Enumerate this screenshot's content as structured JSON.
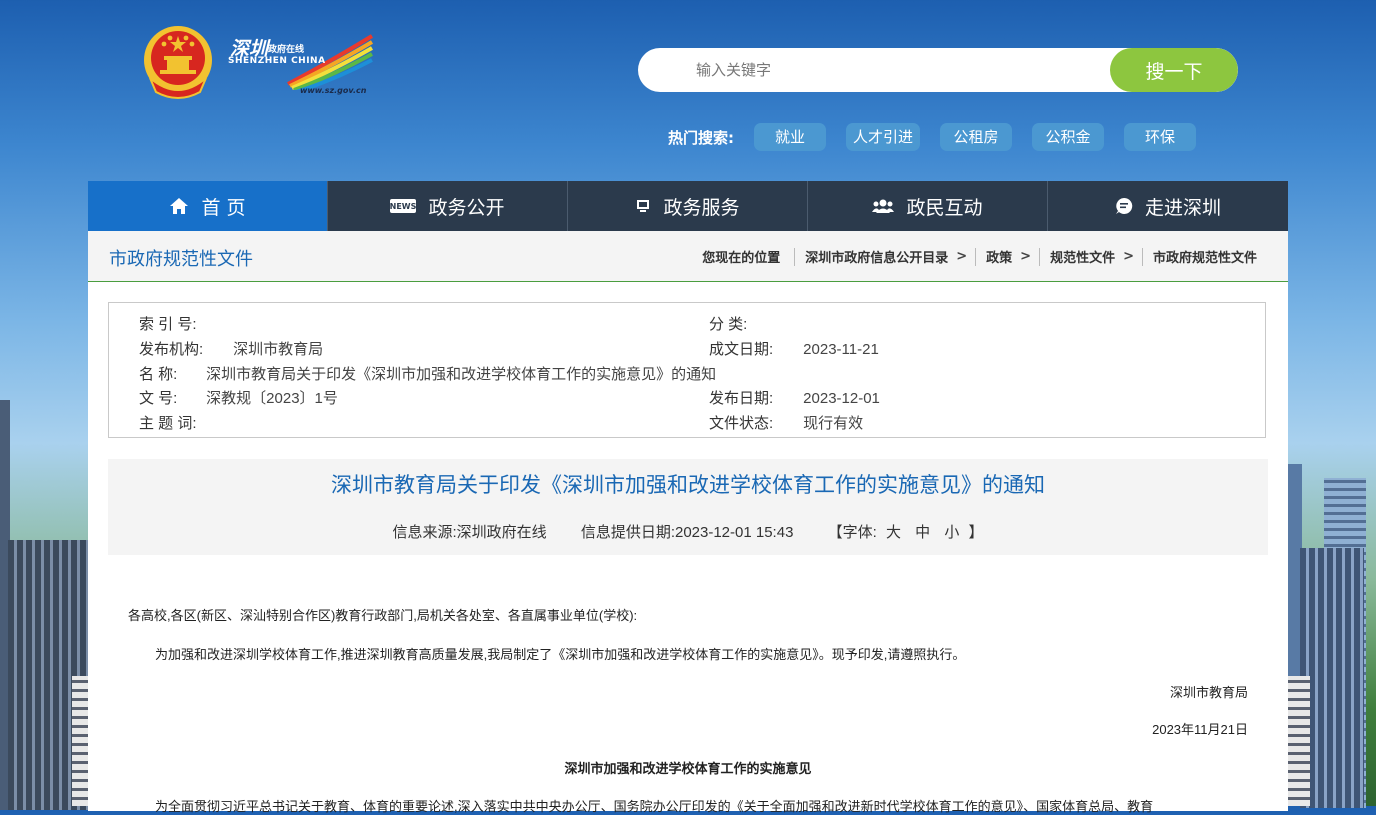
{
  "header": {
    "logo_cn": "深圳",
    "logo_cn2": "政府在线",
    "logo_en": "SHENZHEN CHINA",
    "logo_url": "www.sz.gov.cn",
    "search_placeholder": "输入关键字",
    "search_button": "搜一下",
    "hot_label": "热门搜索:",
    "hot_tags": [
      "就业",
      "人才引进",
      "公租房",
      "公积金",
      "环保"
    ]
  },
  "nav": {
    "items": [
      {
        "label": "首 页",
        "icon": "home-icon"
      },
      {
        "label": "政务公开",
        "icon": "news-icon"
      },
      {
        "label": "政务服务",
        "icon": "monitor-icon"
      },
      {
        "label": "政民互动",
        "icon": "users-icon"
      },
      {
        "label": "走进深圳",
        "icon": "chat-icon"
      }
    ]
  },
  "crumbbar": {
    "section_title": "市政府规范性文件",
    "location_label": "您现在的位置",
    "crumbs": [
      "深圳市政府信息公开目录",
      "政策",
      "规范性文件",
      "市政府规范性文件"
    ],
    "sep": ">"
  },
  "meta": {
    "index_label": "索 引 号:",
    "index_value": "",
    "category_label": "分    类:",
    "category_value": "",
    "issuer_label": "发布机构:",
    "issuer_value": "深圳市教育局",
    "written_date_label": "成文日期:",
    "written_date_value": "2023-11-21",
    "name_label": "名    称:",
    "name_value": "深圳市教育局关于印发《深圳市加强和改进学校体育工作的实施意见》的通知",
    "doc_no_label": "文    号:",
    "doc_no_value": "深教规〔2023〕1号",
    "publish_date_label": "发布日期:",
    "publish_date_value": "2023-12-01",
    "subject_label": "主 题 词:",
    "subject_value": "",
    "status_label": "文件状态:",
    "status_value": "现行有效"
  },
  "doc": {
    "title": "深圳市教育局关于印发《深圳市加强和改进学校体育工作的实施意见》的通知",
    "source": "信息来源:深圳政府在线",
    "provided_date": "信息提供日期:2023-12-01 15:43",
    "font_open": "【字体:",
    "font_large": "大",
    "font_medium": "中",
    "font_small": "小",
    "font_close": "】",
    "p1": "各高校,各区(新区、深汕特别合作区)教育行政部门,局机关各处室、各直属事业单位(学校):",
    "p2": "为加强和改进深圳学校体育工作,推进深圳教育高质量发展,我局制定了《深圳市加强和改进学校体育工作的实施意见》。现予印发,请遵照执行。",
    "signer": "深圳市教育局",
    "sign_date": "2023年11月21日",
    "attachment_title": "深圳市加强和改进学校体育工作的实施意见",
    "p3": "为全面贯彻习近平总书记关于教育、体育的重要论述,深入落实中共中央办公厅、国务院办公厅印发的《关于全面加强和改进新时代学校体育工作的意见》、国家体育总局、教育"
  }
}
